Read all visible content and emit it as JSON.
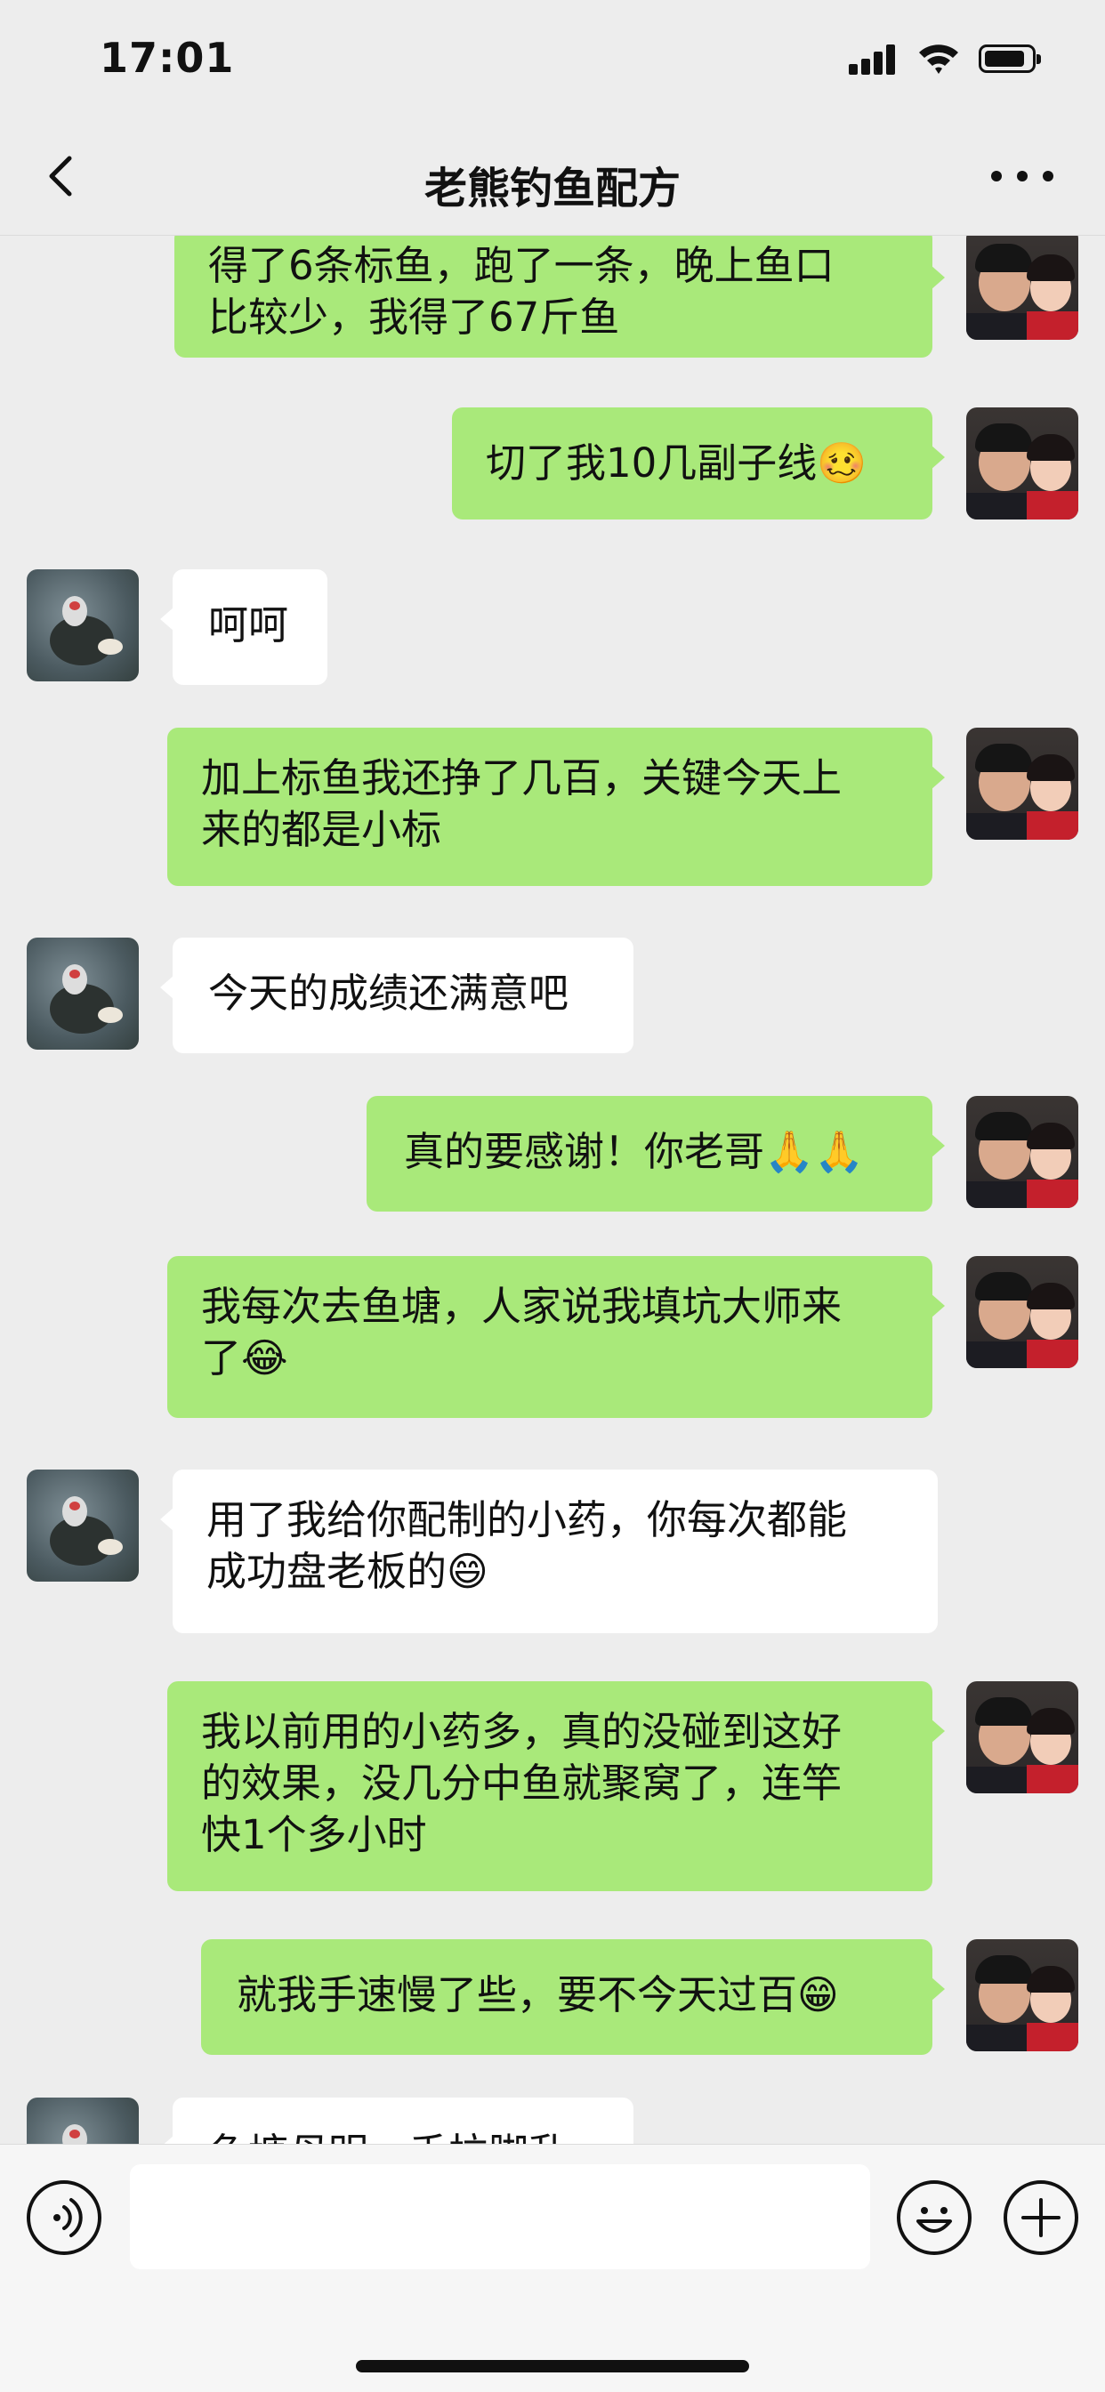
{
  "status_bar": {
    "time": "17:01"
  },
  "header": {
    "title": "老熊钓鱼配方"
  },
  "messages": [
    {
      "side": "right",
      "text": "得了6条标鱼，跑了一条，晚上鱼口\n比较少，我得了67斤鱼"
    },
    {
      "side": "right",
      "text": "切了我10几副子线🥴"
    },
    {
      "side": "left",
      "text": "呵呵"
    },
    {
      "side": "right",
      "text": "加上标鱼我还挣了几百，关键今天上\n来的都是小标"
    },
    {
      "side": "left",
      "text": "今天的成绩还满意吧"
    },
    {
      "side": "right",
      "text": "真的要感谢！你老哥🙏🙏"
    },
    {
      "side": "right",
      "text": "我每次去鱼塘，人家说我填坑大师来\n了😂"
    },
    {
      "side": "left",
      "text": "用了我给你配制的小药，你每次都能\n成功盘老板的😄"
    },
    {
      "side": "right",
      "text": "我以前用的小药多，真的没碰到这好\n的效果，没几分中鱼就聚窝了，连竿\n快1个多小时"
    },
    {
      "side": "right",
      "text": "就我手速慢了些，要不今天过百😁"
    },
    {
      "side": "left",
      "text": "鱼塘母明，舌拉脚乱"
    }
  ],
  "input": {
    "value": "",
    "placeholder": ""
  }
}
